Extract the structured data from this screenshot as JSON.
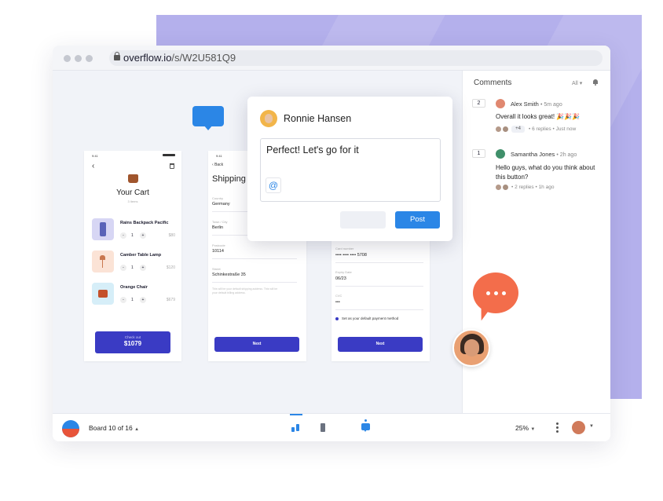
{
  "browser": {
    "url_domain": "overflow.io",
    "url_path": "/s/W2U581Q9"
  },
  "cart_screen": {
    "time": "9:41",
    "title": "Your Cart",
    "subtitle": "3 items",
    "items": [
      {
        "name": "Rains Backpack Pacific",
        "qty": "1",
        "price": "$80",
        "color": "#d7d6f4"
      },
      {
        "name": "Camber Table Lamp",
        "qty": "1",
        "price": "$120",
        "color": "#fbe3d6"
      },
      {
        "name": "Orange Chair",
        "qty": "1",
        "price": "$679",
        "color": "#d6eef8"
      }
    ],
    "checkout_label": "Check out",
    "checkout_total": "$1079"
  },
  "shipping_screen": {
    "time": "9:41",
    "back_label": "Back",
    "title": "Shipping",
    "fields": [
      {
        "label": "Country",
        "value": "Germany"
      },
      {
        "label": "Town / City",
        "value": "Berlin"
      },
      {
        "label": "Postcode",
        "value": "10114"
      },
      {
        "label": "Street",
        "value": "Schinkestraße 35"
      }
    ],
    "note": "This will be your default shipping address. This will be your default billing address.",
    "next_label": "Next"
  },
  "payment_screen": {
    "fields": [
      {
        "label": "Card number",
        "value": "•••• •••• •••• 5708"
      },
      {
        "label": "Expiry Date",
        "value": "06/23"
      },
      {
        "label": "CVC",
        "value": "•••"
      }
    ],
    "default_label": "Set as your default payment method",
    "next_label": "Next"
  },
  "reply_popup": {
    "user": "Ronnie Hansen",
    "text": "Perfect! Let's go for it",
    "mention_symbol": "@",
    "post_label": "Post"
  },
  "comments_panel": {
    "title": "Comments",
    "filter": "All",
    "threads": [
      {
        "number": "2",
        "author": "Alex Smith",
        "time": "5m ago",
        "text": "Overall it looks great! 🎉🎉🎉",
        "extra": "+4",
        "replies": "6 replies",
        "last": "Just now"
      },
      {
        "number": "1",
        "author": "Samantha Jones",
        "time": "2h ago",
        "text": "Hello guys, what do you think about this button?",
        "replies": "2 replies",
        "last": "1h ago"
      }
    ]
  },
  "bottom_bar": {
    "board": "Board 10 of 16",
    "zoom": "25%"
  },
  "colors": {
    "accent": "#3a3bc4",
    "post_button": "#2b86e6",
    "chat_bubble_blue": "#2b86e6",
    "chat_bubble_orange": "#f36d4b",
    "background_panel": "#b4b0ec"
  },
  "icons": [
    "lock-icon",
    "chat-bubble-icon",
    "ellipsis-bubble-icon",
    "bell-icon",
    "mention-icon",
    "kebab-menu-icon",
    "chevron-down-icon"
  ]
}
